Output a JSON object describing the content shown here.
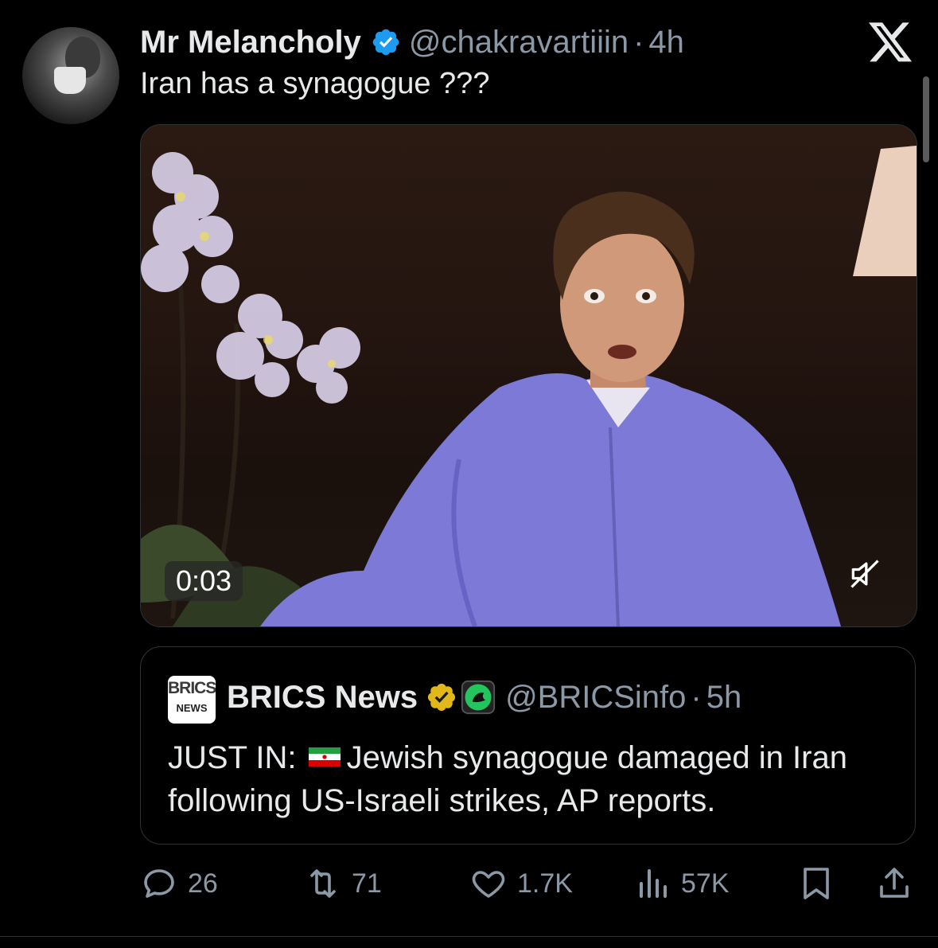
{
  "post": {
    "author_name": "Mr Melancholy",
    "handle": "@chakravartiiin",
    "separator": "·",
    "time": "4h",
    "text": "Iran has a synagogue ???"
  },
  "video": {
    "duration": "0:03",
    "muted": true
  },
  "quote": {
    "avatar_text_top": "BRICS",
    "avatar_text_bottom": "NEWS",
    "author_name": "BRICS News",
    "handle": "@BRICSinfo",
    "separator": "·",
    "time": "5h",
    "text_prefix": "JUST IN:",
    "text_body": "Jewish synagogue damaged in Iran following US-Israeli strikes, AP reports."
  },
  "actions": {
    "replies": "26",
    "reposts": "71",
    "likes": "1.7K",
    "views": "57K"
  },
  "colors": {
    "background": "#000000",
    "text_primary": "#e7e9ea",
    "text_secondary": "#8b98a5",
    "verified_blue": "#1d9bf0",
    "verified_gold": "#e2b719",
    "border": "#2f3336"
  },
  "icons": [
    "x-logo",
    "verified-badge-icon",
    "gold-verified-badge-icon",
    "affiliate-badge-icon",
    "mute-icon",
    "reply-icon",
    "repost-icon",
    "like-icon",
    "views-icon",
    "bookmark-icon",
    "share-icon",
    "iran-flag-icon"
  ]
}
